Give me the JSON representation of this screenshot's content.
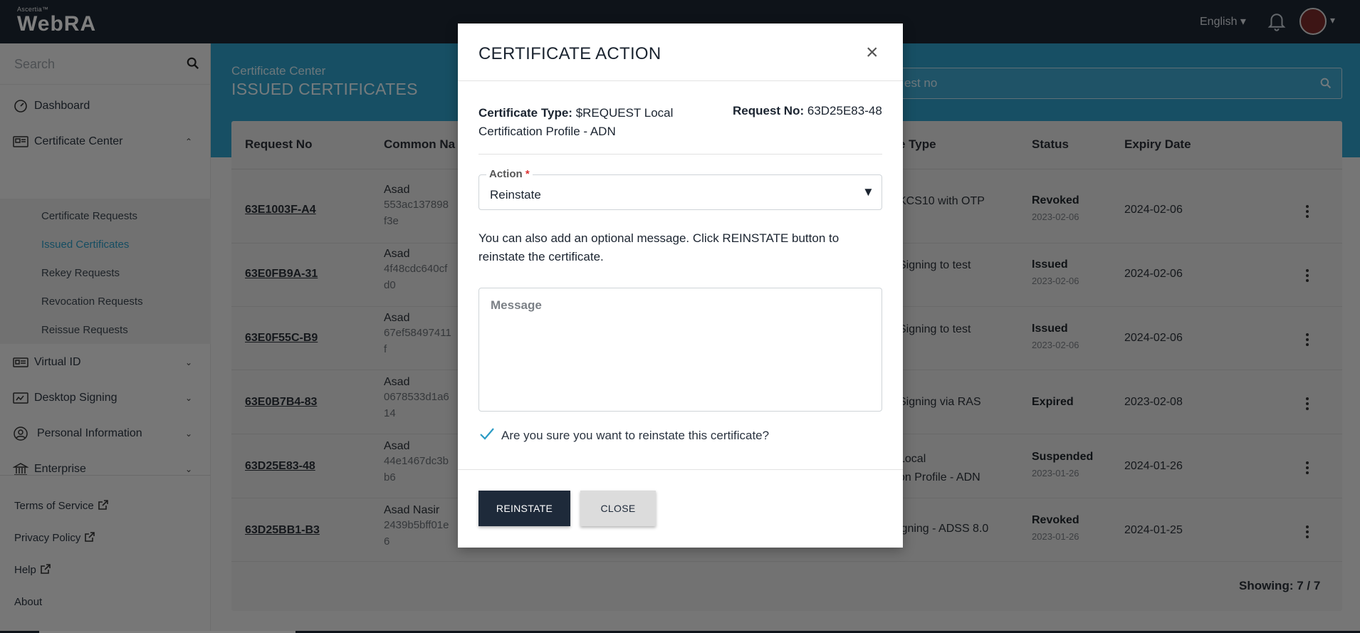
{
  "header": {
    "brand_small": "Ascertia™",
    "brand_name": "WebRA",
    "language": "English ▾",
    "caret": "▾"
  },
  "sidebar": {
    "search_placeholder": "Search",
    "items": [
      {
        "label": "Dashboard"
      },
      {
        "label": "Certificate Center",
        "expanded": true
      },
      {
        "label": "Virtual ID"
      },
      {
        "label": "Desktop Signing"
      },
      {
        "label": "Personal Information"
      },
      {
        "label": "Enterprise"
      }
    ],
    "chevrons": {
      "up": "⌃",
      "down": "⌄"
    },
    "subitems": [
      {
        "label": "Certificate Requests"
      },
      {
        "label": "Issued Certificates",
        "active": true
      },
      {
        "label": "Rekey Requests"
      },
      {
        "label": "Revocation Requests"
      },
      {
        "label": "Reissue Requests"
      }
    ],
    "footer": [
      {
        "label": "Terms of Service",
        "external": true
      },
      {
        "label": "Privacy Policy",
        "external": true
      },
      {
        "label": "Help",
        "external": true
      },
      {
        "label": "About",
        "external": false
      }
    ]
  },
  "page": {
    "breadcrumb": "Certificate Center",
    "title": "ISSUED CERTIFICATES",
    "search_placeholder_visible": "est no"
  },
  "table": {
    "headers": [
      "Request No",
      "Common Na",
      "e Type",
      "Status",
      "Expiry Date"
    ],
    "rows": [
      {
        "req": "63E1003F-A4",
        "cn": "Asad",
        "cn_sub": [
          "553ac137898",
          "f3e"
        ],
        "type": [
          "KCS10 with OTP"
        ],
        "status": "Revoked",
        "status_date": "2023-02-06",
        "expiry": "2024-02-06"
      },
      {
        "req": "63E0FB9A-31",
        "cn": "Asad",
        "cn_sub": [
          "4f48cdc640cf",
          "d0"
        ],
        "type": [
          "Signing to test"
        ],
        "status": "Issued",
        "status_date": "2023-02-06",
        "expiry": "2024-02-06"
      },
      {
        "req": "63E0F55C-B9",
        "cn": "Asad",
        "cn_sub": [
          "67ef58497411",
          "f"
        ],
        "type": [
          "Signing to test"
        ],
        "status": "Issued",
        "status_date": "2023-02-06",
        "expiry": "2024-02-06"
      },
      {
        "req": "63E0B7B4-83",
        "cn": "Asad",
        "cn_sub": [
          "0678533d1a6",
          "14"
        ],
        "type": [
          "Signing via RAS"
        ],
        "status": "Expired",
        "status_date": "",
        "expiry": "2023-02-08"
      },
      {
        "req": "63D25E83-48",
        "cn": "Asad",
        "cn_sub": [
          "44e1467dc3b",
          "b6"
        ],
        "type": [
          "Local",
          "on Profile - ADN"
        ],
        "status": "Suspended",
        "status_date": "2023-01-26",
        "expiry": "2024-01-26"
      },
      {
        "req": "63D25BB1-B3",
        "cn": "Asad Nasir",
        "cn_sub": [
          "2439b5bff01e",
          "6"
        ],
        "type": [
          "igning - ADSS 8.0"
        ],
        "status": "Revoked",
        "status_date": "2023-01-26",
        "expiry": "2024-01-25"
      }
    ],
    "showing": "Showing:  7 / 7"
  },
  "modal": {
    "title": "CERTIFICATE ACTION",
    "close_glyph": "×",
    "cert_type_label": "Certificate Type:",
    "cert_type_value": "$REQUEST Local Certification Profile - ADN",
    "request_no_label": "Request No:",
    "request_no_value": "63D25E83-48",
    "action_label": "Action",
    "required_mark": "*",
    "action_value": "Reinstate",
    "select_caret": "▼",
    "info_text": "You can also add an optional message. Click REINSTATE button to reinstate the certificate.",
    "message_placeholder": "Message",
    "confirm_text": "Are you sure you want to reinstate this certificate?",
    "confirm_checked": true,
    "primary_button": "REINSTATE",
    "secondary_button": "CLOSE"
  }
}
